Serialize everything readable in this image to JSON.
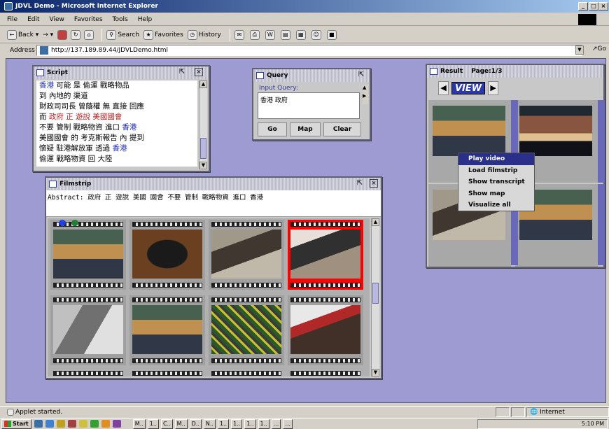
{
  "window": {
    "title": "JDVL Demo - Microsoft Internet Explorer",
    "min": "_",
    "max": "□",
    "close": "×"
  },
  "menu": [
    "File",
    "Edit",
    "View",
    "Favorites",
    "Tools",
    "Help"
  ],
  "toolbar": {
    "back": "Back",
    "forward": "→",
    "search": "Search",
    "favorites": "Favorites",
    "history": "History"
  },
  "address": {
    "label": "Address",
    "url": "http://137.189.89.44/JDVLDemo.html",
    "go": "Go"
  },
  "script": {
    "title": "Script",
    "lines": [
      {
        "segments": [
          {
            "t": "香港",
            "c": "#2030c0"
          },
          {
            "t": " 可能 是 偷運 戰略物品",
            "c": "#000"
          }
        ]
      },
      {
        "segments": [
          {
            "t": "到 內地的 渠道",
            "c": "#000"
          }
        ]
      },
      {
        "segments": [
          {
            "t": "財政司司長 曾蔭權 無 直接 回應",
            "c": "#000"
          }
        ]
      },
      {
        "segments": [
          {
            "t": "而 ",
            "c": "#000"
          },
          {
            "t": "政府 正 遊說 美國國會",
            "c": "#c02020"
          }
        ]
      },
      {
        "segments": [
          {
            "t": "不要 管制 戰略物資 進口 ",
            "c": "#000"
          },
          {
            "t": "香港",
            "c": "#2030c0"
          }
        ]
      },
      {
        "segments": [
          {
            "t": "美國國會 的 考克斯報告 內 提到",
            "c": "#000"
          }
        ]
      },
      {
        "segments": [
          {
            "t": "懷疑 駐港解放軍 透過 ",
            "c": "#000"
          },
          {
            "t": "香港",
            "c": "#2030c0"
          }
        ]
      },
      {
        "segments": [
          {
            "t": "偷運 戰略物資 回 大陸",
            "c": "#000"
          }
        ]
      }
    ]
  },
  "query": {
    "title": "Query",
    "label": "Input Query:",
    "value": "香港 政府",
    "go": "Go",
    "map": "Map",
    "clear": "Clear"
  },
  "filmstrip": {
    "title": "Filmstrip",
    "abstract": "Abstract: 政府 正 遊說 美國 國會 不要 管制 戰略物資 進口 香港",
    "thumbnails": [
      "news anchors",
      "book",
      "crowd",
      "reporters",
      "laboratory",
      "news anchors",
      "circuit board",
      "street crowd"
    ],
    "selected_index": 3
  },
  "result": {
    "title": "Result",
    "page": "Page:1/3",
    "view": "VIEW",
    "thumbnails": [
      "news anchors",
      "female anchor",
      "official",
      "news anchors"
    ]
  },
  "context_menu": {
    "items": [
      "Play video",
      "Load filmstrip",
      "Show transcript",
      "Show map",
      "Visualize all"
    ],
    "selected": "Play video"
  },
  "status": {
    "text": "Applet started.",
    "zone": "Internet"
  },
  "taskbar": {
    "start": "Start",
    "tasks": [
      "M..",
      "1..",
      "C..",
      "M..",
      "D..",
      "N..",
      "1..",
      "1..",
      "1..",
      "1..",
      "...",
      "..."
    ],
    "time": "5:10 PM"
  },
  "colors": {
    "desktop": "#9e9bd2",
    "selection": "#ff0000",
    "menu_highlight": "#2a2f8a"
  }
}
